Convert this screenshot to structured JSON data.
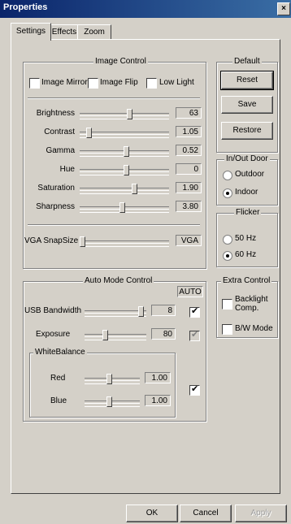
{
  "window": {
    "title": "Properties",
    "close_glyph": "×"
  },
  "tabs": [
    {
      "label": "Settings",
      "active": true
    },
    {
      "label": "Effects",
      "active": false
    },
    {
      "label": "Zoom",
      "active": false
    }
  ],
  "image_control": {
    "title": "Image Control",
    "checkboxes": [
      {
        "label": "Image Mirror",
        "checked": false
      },
      {
        "label": "Image Flip",
        "checked": false
      },
      {
        "label": "Low Light",
        "checked": false
      }
    ],
    "sliders": [
      {
        "label": "Brightness",
        "value": "63",
        "level": 0.56
      },
      {
        "label": "Contrast",
        "value": "1.05",
        "level": 0.08
      },
      {
        "label": "Gamma",
        "value": "0.52",
        "level": 0.52
      },
      {
        "label": "Hue",
        "value": "0",
        "level": 0.52
      },
      {
        "label": "Saturation",
        "value": "1.90",
        "level": 0.62
      },
      {
        "label": "Sharpness",
        "value": "3.80",
        "level": 0.48
      }
    ],
    "vga": {
      "label": "VGA SnapSize",
      "value": "VGA",
      "level": 0.0
    }
  },
  "default": {
    "title": "Default",
    "reset": "Reset",
    "save": "Save",
    "restore": "Restore"
  },
  "inout": {
    "title": "In/Out Door",
    "outdoor": "Outdoor",
    "indoor": "Indoor",
    "selected": "indoor"
  },
  "flicker": {
    "title": "Flicker",
    "hz50": "50 Hz",
    "hz60": "60 Hz",
    "selected": "60hz"
  },
  "extra": {
    "title": "Extra Control",
    "backlight_line1": "Backlight",
    "backlight_line2": "Comp.",
    "bw": "B/W Mode"
  },
  "auto_mode": {
    "title": "Auto Mode Control",
    "auto_label": "AUTO",
    "usb": {
      "label": "USB Bandwidth",
      "value": "8",
      "level": 0.95,
      "auto": true
    },
    "exposure": {
      "label": "Exposure",
      "value": "80",
      "level": 0.32,
      "auto": true
    },
    "white_balance": {
      "title": "WhiteBalance",
      "red": {
        "label": "Red",
        "value": "1.00",
        "level": 0.45
      },
      "blue": {
        "label": "Blue",
        "value": "1.00",
        "level": 0.45
      },
      "auto": true
    }
  },
  "footer": {
    "ok": "OK",
    "cancel": "Cancel",
    "apply": "Apply"
  }
}
